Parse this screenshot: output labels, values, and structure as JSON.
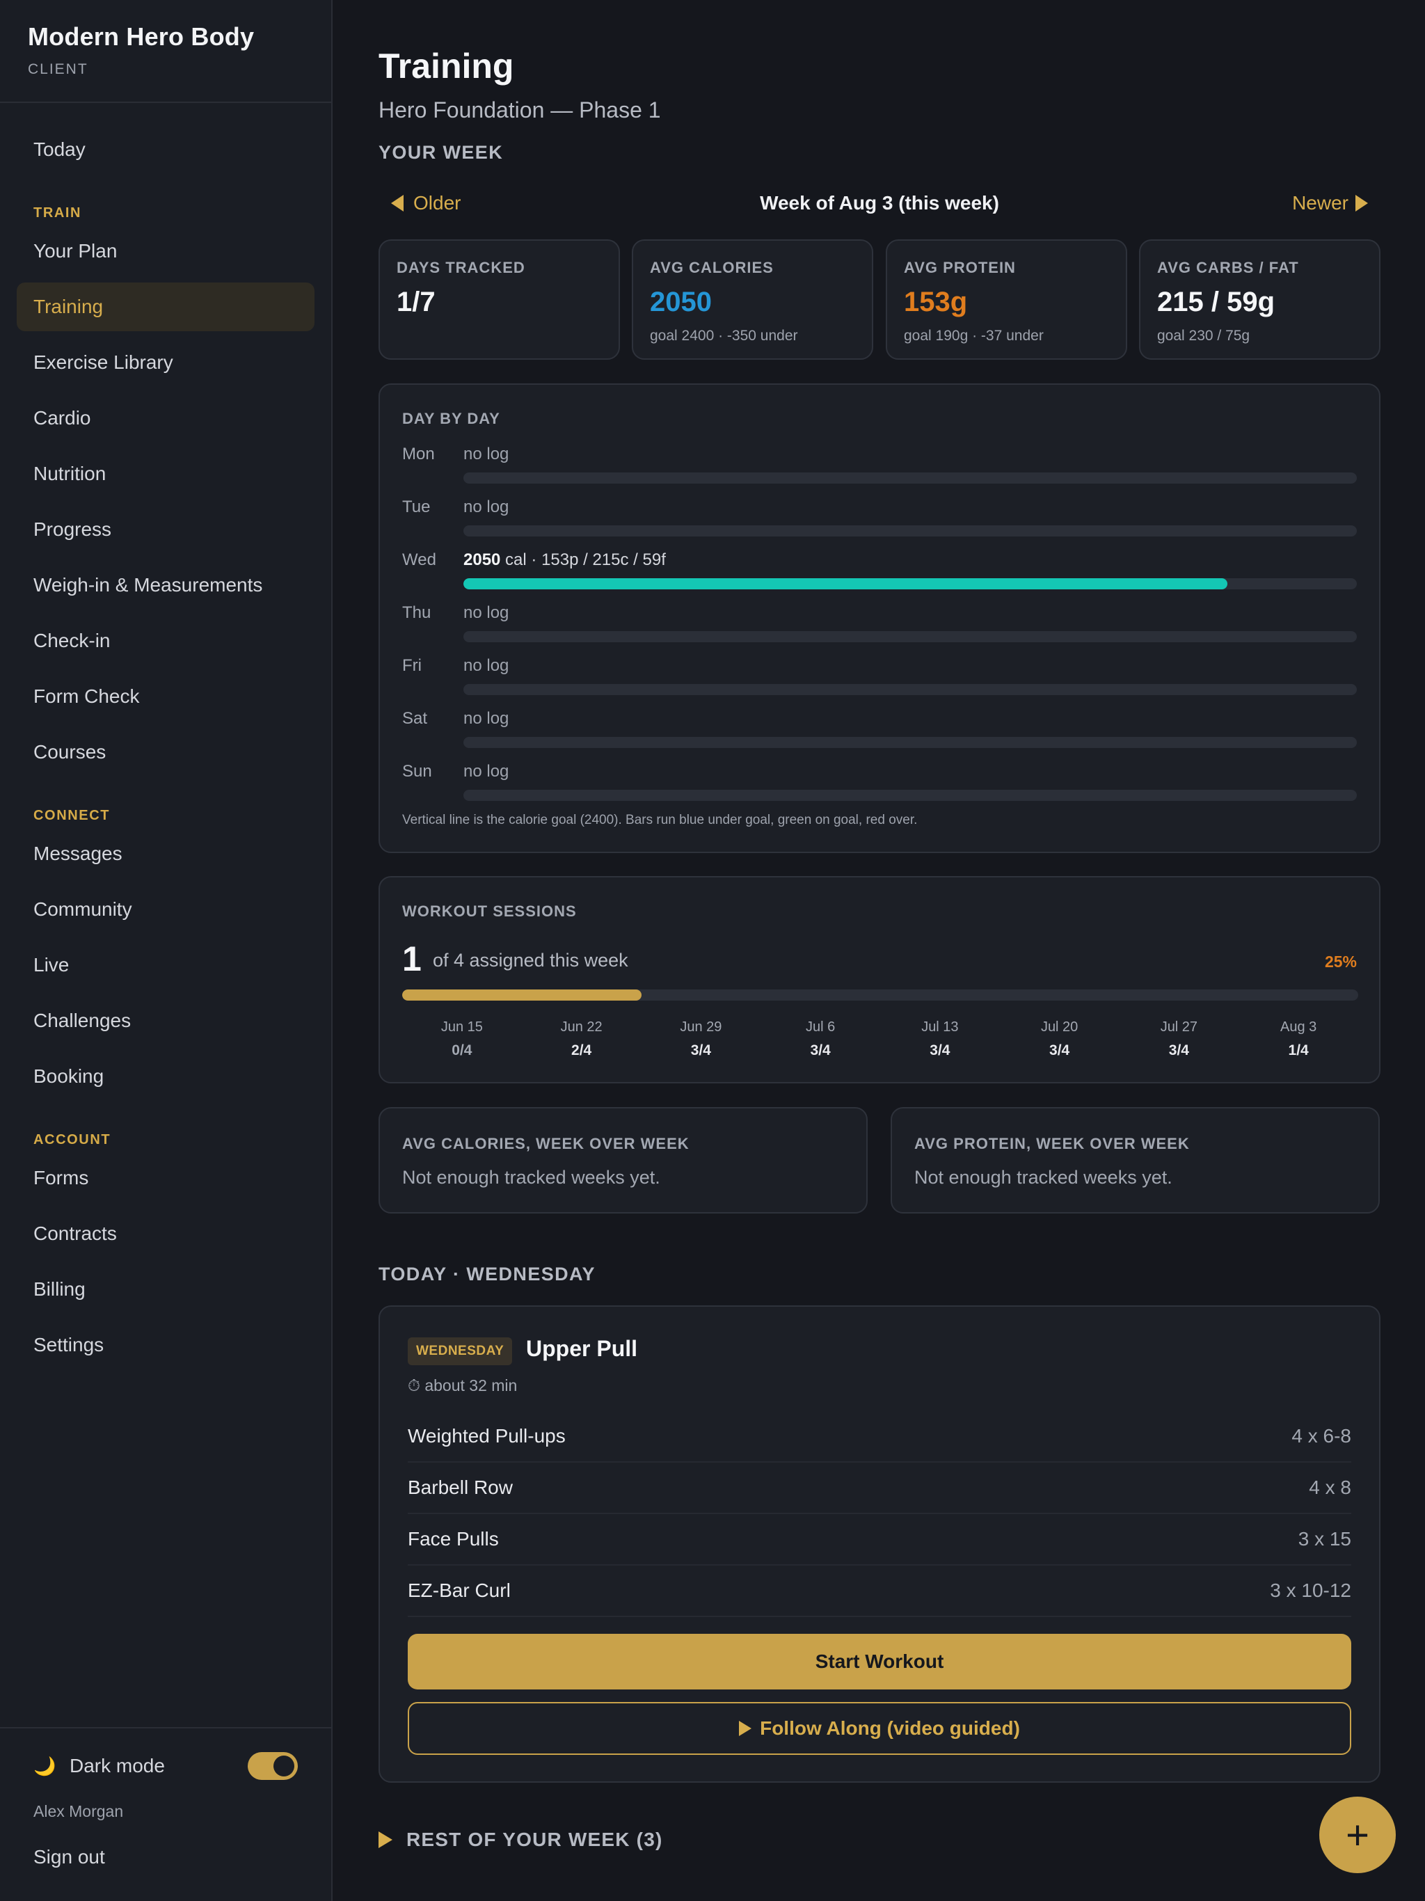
{
  "brand": {
    "title": "Modern Hero Body",
    "subtitle": "CLIENT"
  },
  "nav": {
    "today": "Today",
    "train_section": "TRAIN",
    "train": [
      "Your Plan",
      "Training",
      "Exercise Library",
      "Cardio",
      "Nutrition",
      "Progress",
      "Weigh-in & Measurements",
      "Check-in",
      "Form Check",
      "Courses"
    ],
    "active": "Training",
    "connect_section": "CONNECT",
    "connect": [
      "Messages",
      "Community",
      "Live",
      "Challenges",
      "Booking"
    ],
    "account_section": "ACCOUNT",
    "account": [
      "Forms",
      "Contracts",
      "Billing",
      "Settings"
    ]
  },
  "sidebar_footer": {
    "dark_mode_label": "Dark mode",
    "dark_mode_icon": "moon-icon",
    "dark_mode_on": true,
    "user_name": "Alex Morgan",
    "sign_out": "Sign out"
  },
  "page": {
    "title": "Training",
    "subtitle": "Hero Foundation — Phase 1",
    "your_week_heading": "YOUR WEEK"
  },
  "week_nav": {
    "older": "Older",
    "label": "Week of Aug 3 (this week)",
    "newer": "Newer"
  },
  "stats": [
    {
      "label": "DAYS TRACKED",
      "value": "1/7",
      "note": "",
      "color": "#f5f6f8"
    },
    {
      "label": "AVG CALORIES",
      "value": "2050",
      "note": "goal 2400 · -350 under",
      "color": "#2596d6"
    },
    {
      "label": "AVG PROTEIN",
      "value": "153g",
      "note": "goal 190g · -37 under",
      "color": "#e07d1e"
    },
    {
      "label": "AVG CARBS / FAT",
      "value": "215 / 59g",
      "note": "goal 230 / 75g",
      "color": "#f5f6f8"
    }
  ],
  "day_by_day": {
    "heading": "DAY BY DAY",
    "days": [
      {
        "day": "Mon",
        "info": "no log",
        "fill": 0
      },
      {
        "day": "Tue",
        "info": "no log",
        "fill": 0
      },
      {
        "day": "Wed",
        "calories": "2050",
        "info": " cal · 153p / 215c / 59f",
        "fill": 0.855
      },
      {
        "day": "Thu",
        "info": "no log",
        "fill": 0
      },
      {
        "day": "Fri",
        "info": "no log",
        "fill": 0
      },
      {
        "day": "Sat",
        "info": "no log",
        "fill": 0
      },
      {
        "day": "Sun",
        "info": "no log",
        "fill": 0
      }
    ],
    "footnote": "Vertical line is the calorie goal (2400). Bars run blue under goal, green on goal, red over."
  },
  "workout_sessions": {
    "heading": "WORKOUT SESSIONS",
    "completed": "1",
    "of_text": "of 4 assigned this week",
    "percent": "25%",
    "fill": 0.25,
    "weeks": [
      {
        "date": "Jun 15",
        "value": "0/4"
      },
      {
        "date": "Jun 22",
        "value": "2/4"
      },
      {
        "date": "Jun 29",
        "value": "3/4"
      },
      {
        "date": "Jul 6",
        "value": "3/4"
      },
      {
        "date": "Jul 13",
        "value": "3/4"
      },
      {
        "date": "Jul 20",
        "value": "3/4"
      },
      {
        "date": "Jul 27",
        "value": "3/4"
      },
      {
        "date": "Aug 3",
        "value": "1/4"
      }
    ]
  },
  "week_over_week": [
    {
      "heading": "AVG CALORIES, WEEK OVER WEEK",
      "note": "Not enough tracked weeks yet."
    },
    {
      "heading": "AVG PROTEIN, WEEK OVER WEEK",
      "note": "Not enough tracked weeks yet."
    }
  ],
  "today": {
    "heading": "TODAY · WEDNESDAY",
    "badge": "WEDNESDAY",
    "workout_title": "Upper Pull",
    "duration": "⏱ about 32 min",
    "exercises": [
      {
        "name": "Weighted Pull-ups",
        "sets": "4 x 6-8"
      },
      {
        "name": "Barbell Row",
        "sets": "4 x 8"
      },
      {
        "name": "Face Pulls",
        "sets": "3 x 15"
      },
      {
        "name": "EZ-Bar Curl",
        "sets": "3 x 10-12"
      }
    ],
    "start_button": "Start Workout",
    "follow_button": "Follow Along (video guided)"
  },
  "rest_of_week": "REST OF YOUR WEEK (3)",
  "fab": "+"
}
